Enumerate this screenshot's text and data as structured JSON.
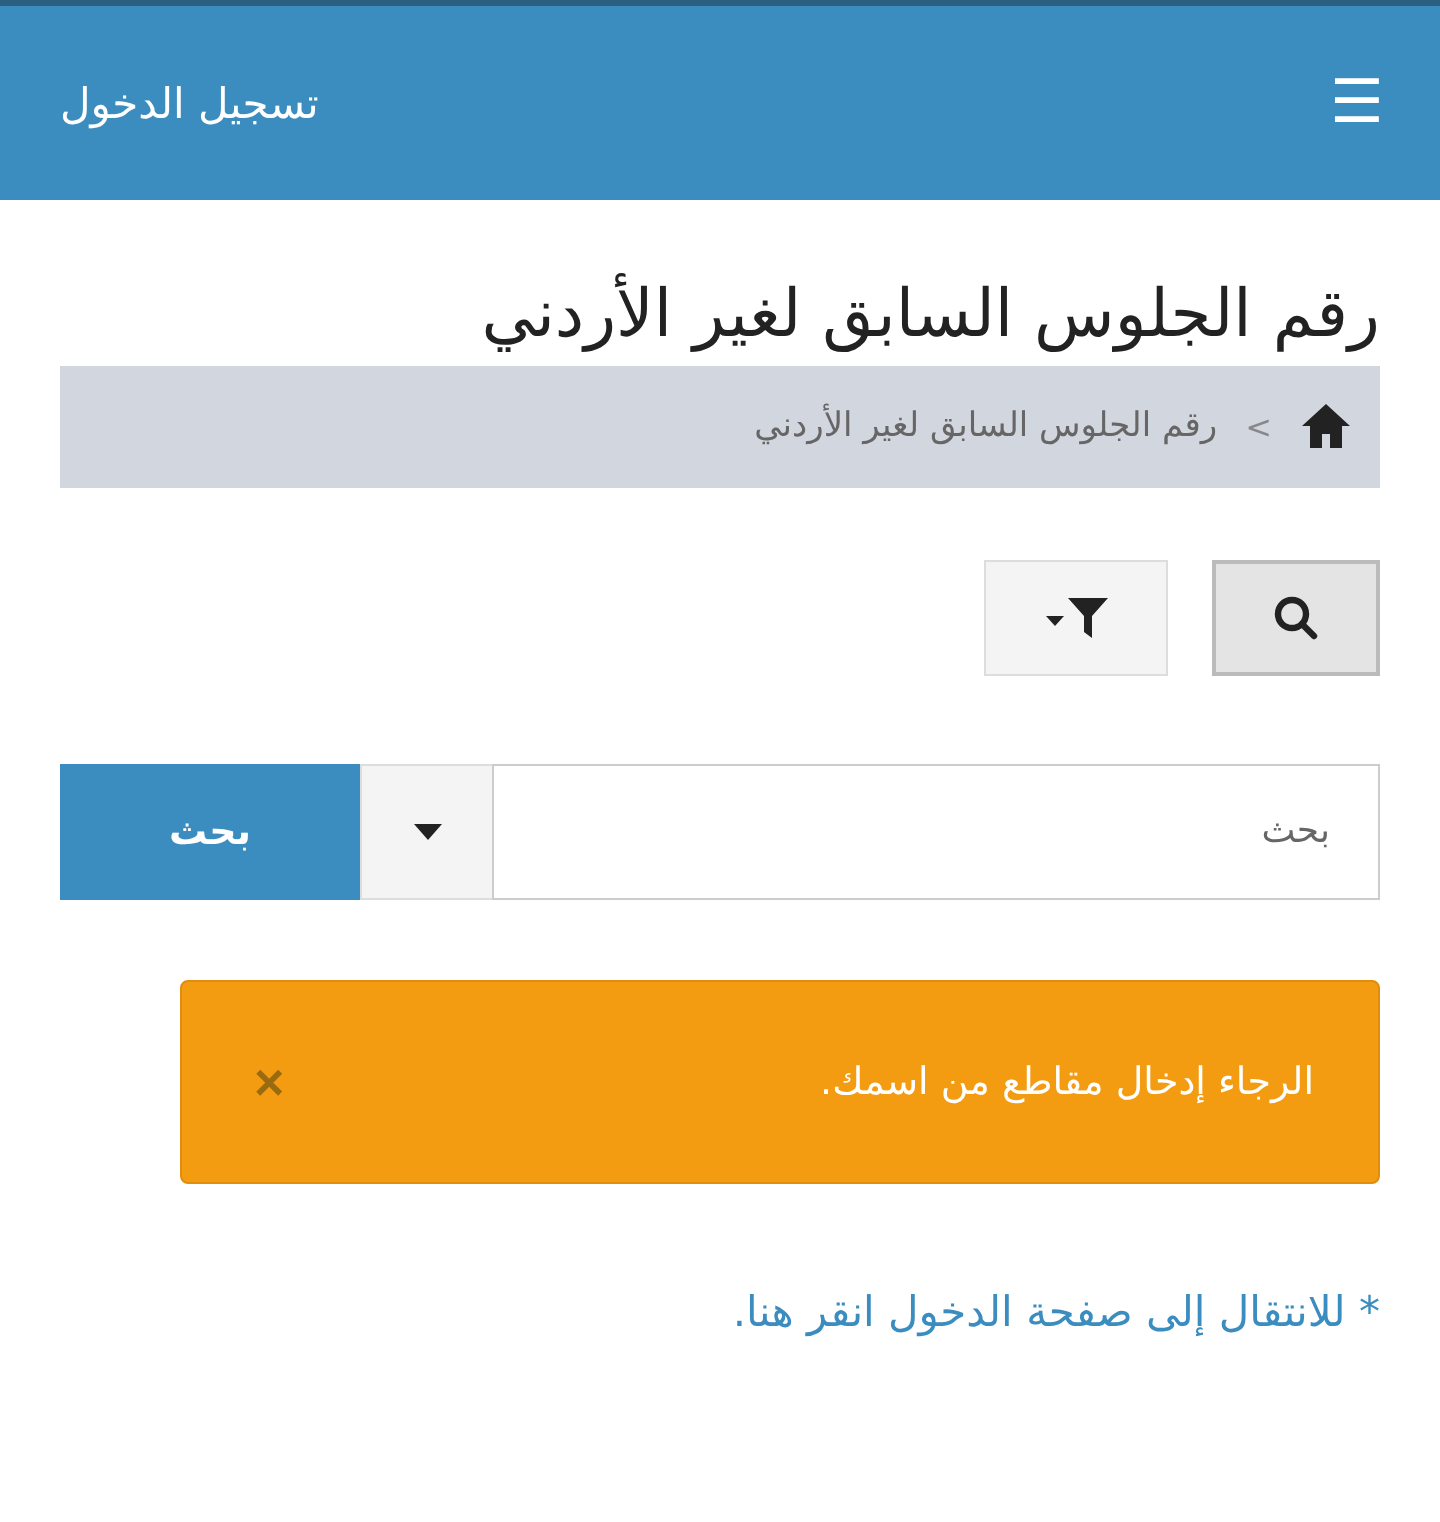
{
  "header": {
    "menu_icon": "☰",
    "title": "تسجيل الدخول"
  },
  "page_title": "رقم الجلوس السابق لغير الأردني",
  "breadcrumb": {
    "separator": ">",
    "items": [
      "رقم الجلوس السابق لغير الأردني"
    ]
  },
  "view_toggles": [
    {
      "kind": "search",
      "selected": true
    },
    {
      "kind": "filter",
      "selected": false
    }
  ],
  "search": {
    "placeholder": "بحث",
    "button": "بحث"
  },
  "alert": {
    "message": "الرجاء إدخال مقاطع من اسمك.",
    "close": "×"
  },
  "login_link": "* للانتقال إلى صفحة الدخول انقر هنا."
}
